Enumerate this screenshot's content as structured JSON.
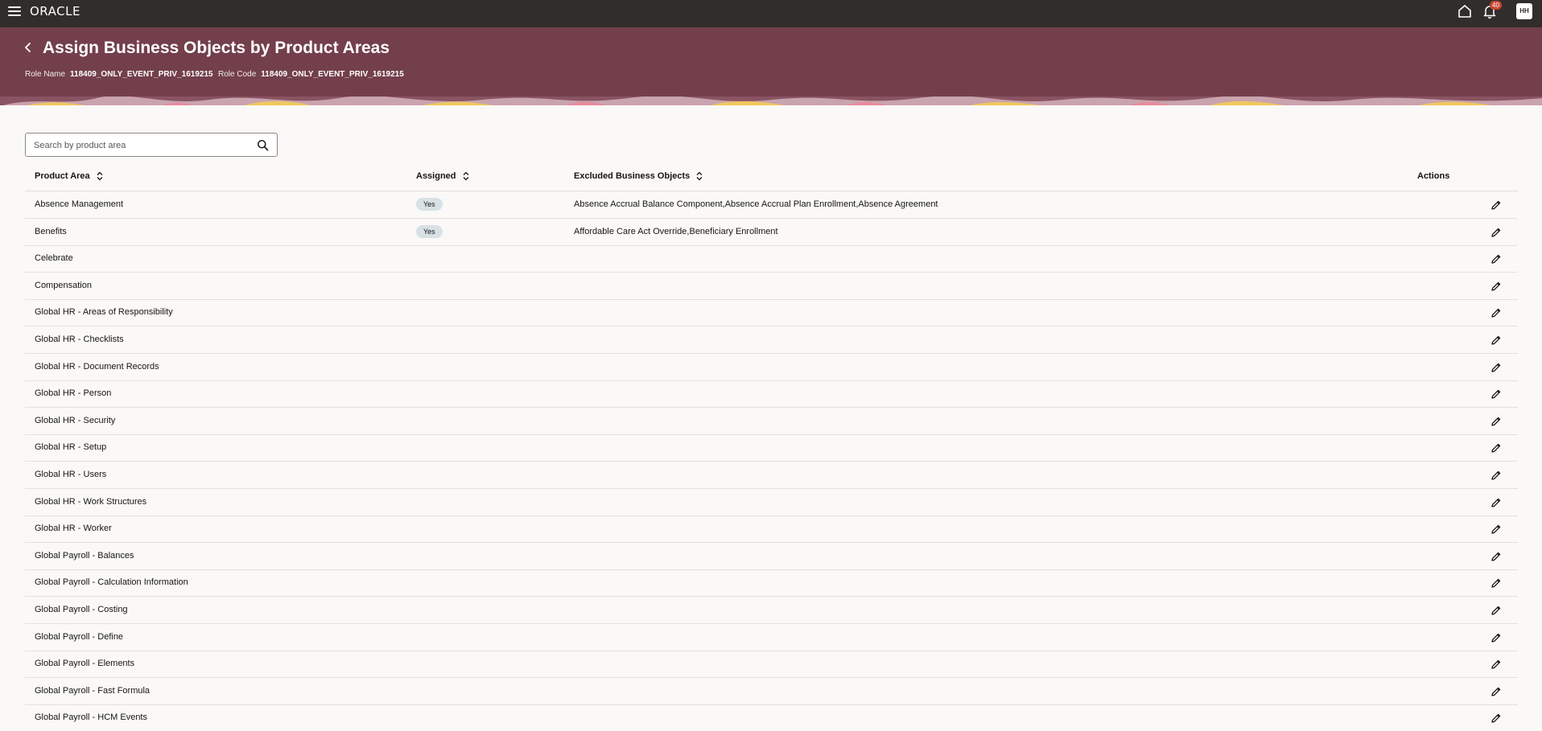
{
  "topbar": {
    "brand": "ORACLE",
    "notification_count": "40",
    "avatar_initials": "HH",
    "icons": [
      "menu-icon",
      "home-icon",
      "bell-icon"
    ]
  },
  "header": {
    "title": "Assign Business Objects by Product Areas",
    "role_name_label": "Role Name",
    "role_name_value": "118409_ONLY_EVENT_PRIV_1619215",
    "role_code_label": "Role Code",
    "role_code_value": "118409_ONLY_EVENT_PRIV_1619215",
    "band_color": "#733f4b"
  },
  "search": {
    "placeholder": "Search by product area",
    "value": ""
  },
  "table": {
    "columns": {
      "product_area": "Product Area",
      "assigned": "Assigned",
      "excluded": "Excluded Business Objects",
      "actions": "Actions"
    },
    "rows": [
      {
        "product_area": "Absence Management",
        "assigned": "Yes",
        "excluded": "Absence Accrual Balance Component,Absence Accrual Plan Enrollment,Absence Agreement"
      },
      {
        "product_area": "Benefits",
        "assigned": "Yes",
        "excluded": "Affordable Care Act Override,Beneficiary Enrollment"
      },
      {
        "product_area": "Celebrate",
        "assigned": "",
        "excluded": ""
      },
      {
        "product_area": "Compensation",
        "assigned": "",
        "excluded": ""
      },
      {
        "product_area": "Global HR - Areas of Responsibility",
        "assigned": "",
        "excluded": ""
      },
      {
        "product_area": "Global HR - Checklists",
        "assigned": "",
        "excluded": ""
      },
      {
        "product_area": "Global HR - Document Records",
        "assigned": "",
        "excluded": ""
      },
      {
        "product_area": "Global HR - Person",
        "assigned": "",
        "excluded": ""
      },
      {
        "product_area": "Global HR - Security",
        "assigned": "",
        "excluded": ""
      },
      {
        "product_area": "Global HR - Setup",
        "assigned": "",
        "excluded": ""
      },
      {
        "product_area": "Global HR - Users",
        "assigned": "",
        "excluded": ""
      },
      {
        "product_area": "Global HR - Work Structures",
        "assigned": "",
        "excluded": ""
      },
      {
        "product_area": "Global HR - Worker",
        "assigned": "",
        "excluded": ""
      },
      {
        "product_area": "Global Payroll - Balances",
        "assigned": "",
        "excluded": ""
      },
      {
        "product_area": "Global Payroll - Calculation Information",
        "assigned": "",
        "excluded": ""
      },
      {
        "product_area": "Global Payroll - Costing",
        "assigned": "",
        "excluded": ""
      },
      {
        "product_area": "Global Payroll - Define",
        "assigned": "",
        "excluded": ""
      },
      {
        "product_area": "Global Payroll - Elements",
        "assigned": "",
        "excluded": ""
      },
      {
        "product_area": "Global Payroll - Fast Formula",
        "assigned": "",
        "excluded": ""
      },
      {
        "product_area": "Global Payroll - HCM Events",
        "assigned": "",
        "excluded": ""
      }
    ]
  }
}
